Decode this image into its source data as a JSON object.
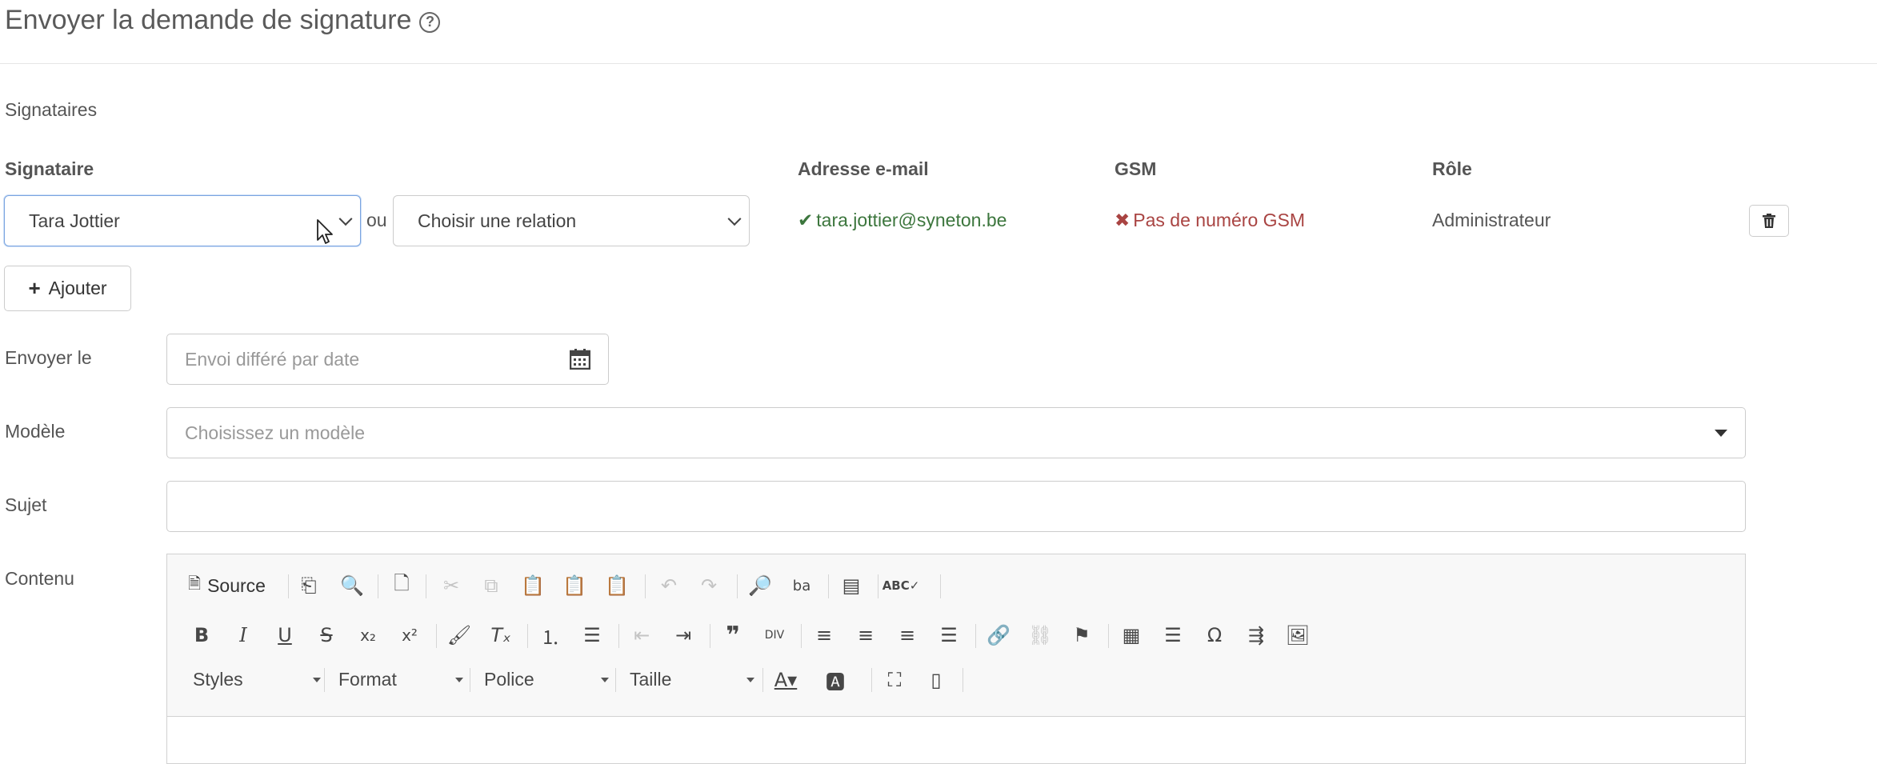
{
  "header": {
    "title": "Envoyer la demande de signature",
    "help_icon": "question-circle-icon"
  },
  "signataires_section_label": "Signataires",
  "columns": {
    "signer": "Signataire",
    "email": "Adresse e-mail",
    "gsm": "GSM",
    "role": "Rôle"
  },
  "signer_row": {
    "signer_value": "Tara Jottier",
    "or_text": "ou",
    "relation_placeholder": "Choisir une relation",
    "email": "tara.jottier@syneton.be",
    "gsm": "Pas de numéro GSM",
    "role": "Administrateur"
  },
  "add_button": {
    "icon": "plus-icon",
    "label": "Ajouter"
  },
  "form": {
    "send_date_label": "Envoyer le",
    "send_date_placeholder": "Envoi différé par date",
    "template_label": "Modèle",
    "template_placeholder": "Choisissez un modèle",
    "subject_label": "Sujet",
    "subject_value": "",
    "content_label": "Contenu"
  },
  "editor": {
    "source_label": "Source",
    "combos": [
      "Styles",
      "Format",
      "Police",
      "Taille"
    ]
  },
  "colors": {
    "success": "#3c763d",
    "danger": "#a94442",
    "focus_border": "#7aa4e0"
  }
}
